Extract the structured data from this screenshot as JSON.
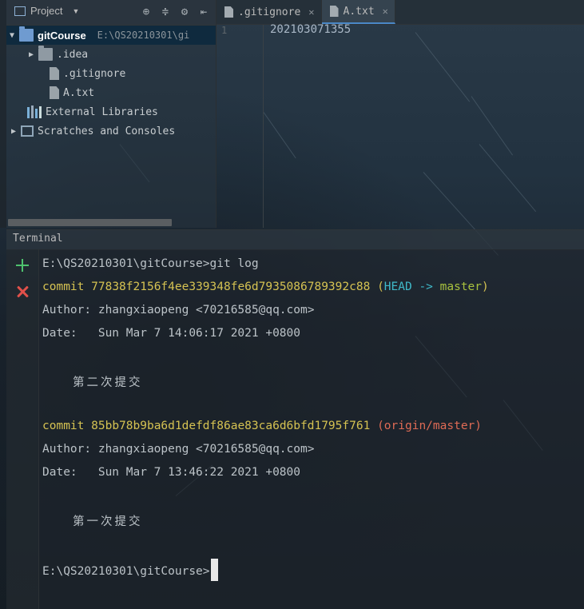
{
  "project_panel": {
    "title": "Project",
    "tree": [
      {
        "label": "gitCourse",
        "path": "E:\\QS20210301\\gi"
      },
      {
        "label": ".idea"
      },
      {
        "label": ".gitignore"
      },
      {
        "label": "A.txt"
      },
      {
        "label": "External Libraries"
      },
      {
        "label": "Scratches and Consoles"
      }
    ]
  },
  "editor": {
    "tabs": [
      {
        "label": ".gitignore"
      },
      {
        "label": "A.txt"
      }
    ],
    "line_number": "1",
    "content": "202103071355"
  },
  "terminal": {
    "title": "Terminal",
    "prompt1": "E:\\QS20210301\\gitCourse>git log",
    "commit1": {
      "label": "commit",
      "hash": "77838f2156f4ee339348fe6d7935086789392c88",
      "paren_open": "(",
      "head": "HEAD ->",
      "branch": "master",
      "paren_close": ")"
    },
    "author1": "Author: zhangxiaopeng <70216585@qq.com>",
    "date1": "Date:   Sun Mar 7 14:06:17 2021 +0800",
    "message1": "第二次提交",
    "commit2": {
      "label": "commit",
      "hash": "85bb78b9ba6d1defdf86ae83ca6d6bfd1795f761",
      "ref": "(origin/master)"
    },
    "author2": "Author: zhangxiaopeng <70216585@qq.com>",
    "date2": "Date:   Sun Mar 7 13:46:22 2021 +0800",
    "message2": "第一次提交",
    "prompt2": "E:\\QS20210301\\gitCourse>"
  },
  "icons": {
    "new_session": "plus-icon",
    "close_session": "close-icon"
  },
  "colors": {
    "commit_yellow": "#d5c252",
    "head_cyan": "#3fb9c9",
    "branch_green": "#a8c23e",
    "remote_red": "#df6b55",
    "selection_blue": "#0d293e"
  }
}
